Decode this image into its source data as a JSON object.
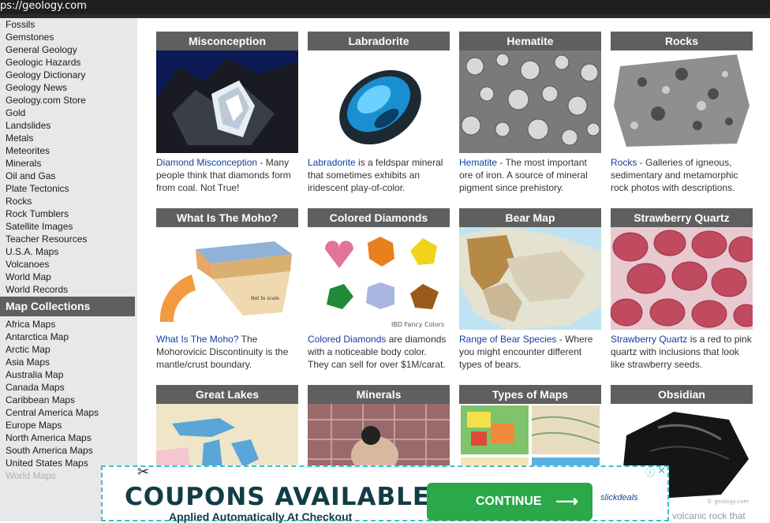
{
  "url": "ps://geology.com",
  "sidebar": {
    "items": [
      "Fossils",
      "Gemstones",
      "General Geology",
      "Geologic Hazards",
      "Geology Dictionary",
      "Geology News",
      "Geology.com Store",
      "Gold",
      "Landslides",
      "Metals",
      "Meteorites",
      "Minerals",
      "Oil and Gas",
      "Plate Tectonics",
      "Rocks",
      "Rock Tumblers",
      "Satellite Images",
      "Teacher Resources",
      "U.S.A. Maps",
      "Volcanoes",
      "World Map",
      "World Records"
    ],
    "map_heading": "Map Collections",
    "map_items": [
      "Africa Maps",
      "Antarctica Map",
      "Arctic Map",
      "Asia Maps",
      "Australia Map",
      "Canada Maps",
      "Caribbean Maps",
      "Central America Maps",
      "Europe Maps",
      "North America Maps",
      "South America Maps",
      "United States Maps",
      "World Maps"
    ]
  },
  "cards": [
    {
      "title": "Misconception",
      "link": "Diamond Misconception",
      "text": " - Many people think that diamonds form from coal. Not True!"
    },
    {
      "title": "Labradorite",
      "link": "Labradorite",
      "text": " is a feldspar mineral that sometimes exhibits an iridescent play-of-color."
    },
    {
      "title": "Hematite",
      "link": "Hematite",
      "text": " - The most important ore of iron. A source of mineral pigment since prehistory."
    },
    {
      "title": "Rocks",
      "link": "Rocks",
      "text": " - Galleries of igneous, sedimentary and metamorphic rock photos with descriptions."
    },
    {
      "title": "What Is The Moho?",
      "link": "What Is The Moho?",
      "text": " The Mohorovicic Discontinuity is the mantle/crust boundary."
    },
    {
      "title": "Colored Diamonds",
      "link": "Colored Diamonds",
      "text": " are diamonds with a noticeable body color. They can sell for over $1M/carat."
    },
    {
      "title": "Bear Map",
      "link": "Range of Bear Species",
      "text": " - Where you might encounter different types of bears."
    },
    {
      "title": "Strawberry Quartz",
      "link": "Strawberry Quartz",
      "text": " is a red to pink quartz with inclusions that look like strawberry seeds."
    },
    {
      "title": "Great Lakes",
      "link": "",
      "text": ""
    },
    {
      "title": "Minerals",
      "link": "",
      "text": ""
    },
    {
      "title": "Types of Maps",
      "link": "",
      "text": ""
    },
    {
      "title": "Obsidian",
      "link": "",
      "text": ""
    }
  ],
  "image_captions": {
    "colored_diamonds": "IBD Fancy Colors",
    "obsidian": "© geology.com",
    "moho_not_to_scale": "Not to scale"
  },
  "under_ad_text": "volcanic rock that",
  "ad": {
    "headline": "COUPONS AVAILABLE",
    "sub": "Applied Automatically At Checkout",
    "button": "CONTINUE",
    "brand": "slickdeals",
    "info": "ⓘ",
    "close": "✕"
  },
  "colors": {
    "header_bar": "#5f5f5f",
    "link": "#1040a0",
    "sidebar_bg": "#e8e8e8",
    "ad_border": "#3bbfcf",
    "ad_button": "#2ba84a"
  }
}
